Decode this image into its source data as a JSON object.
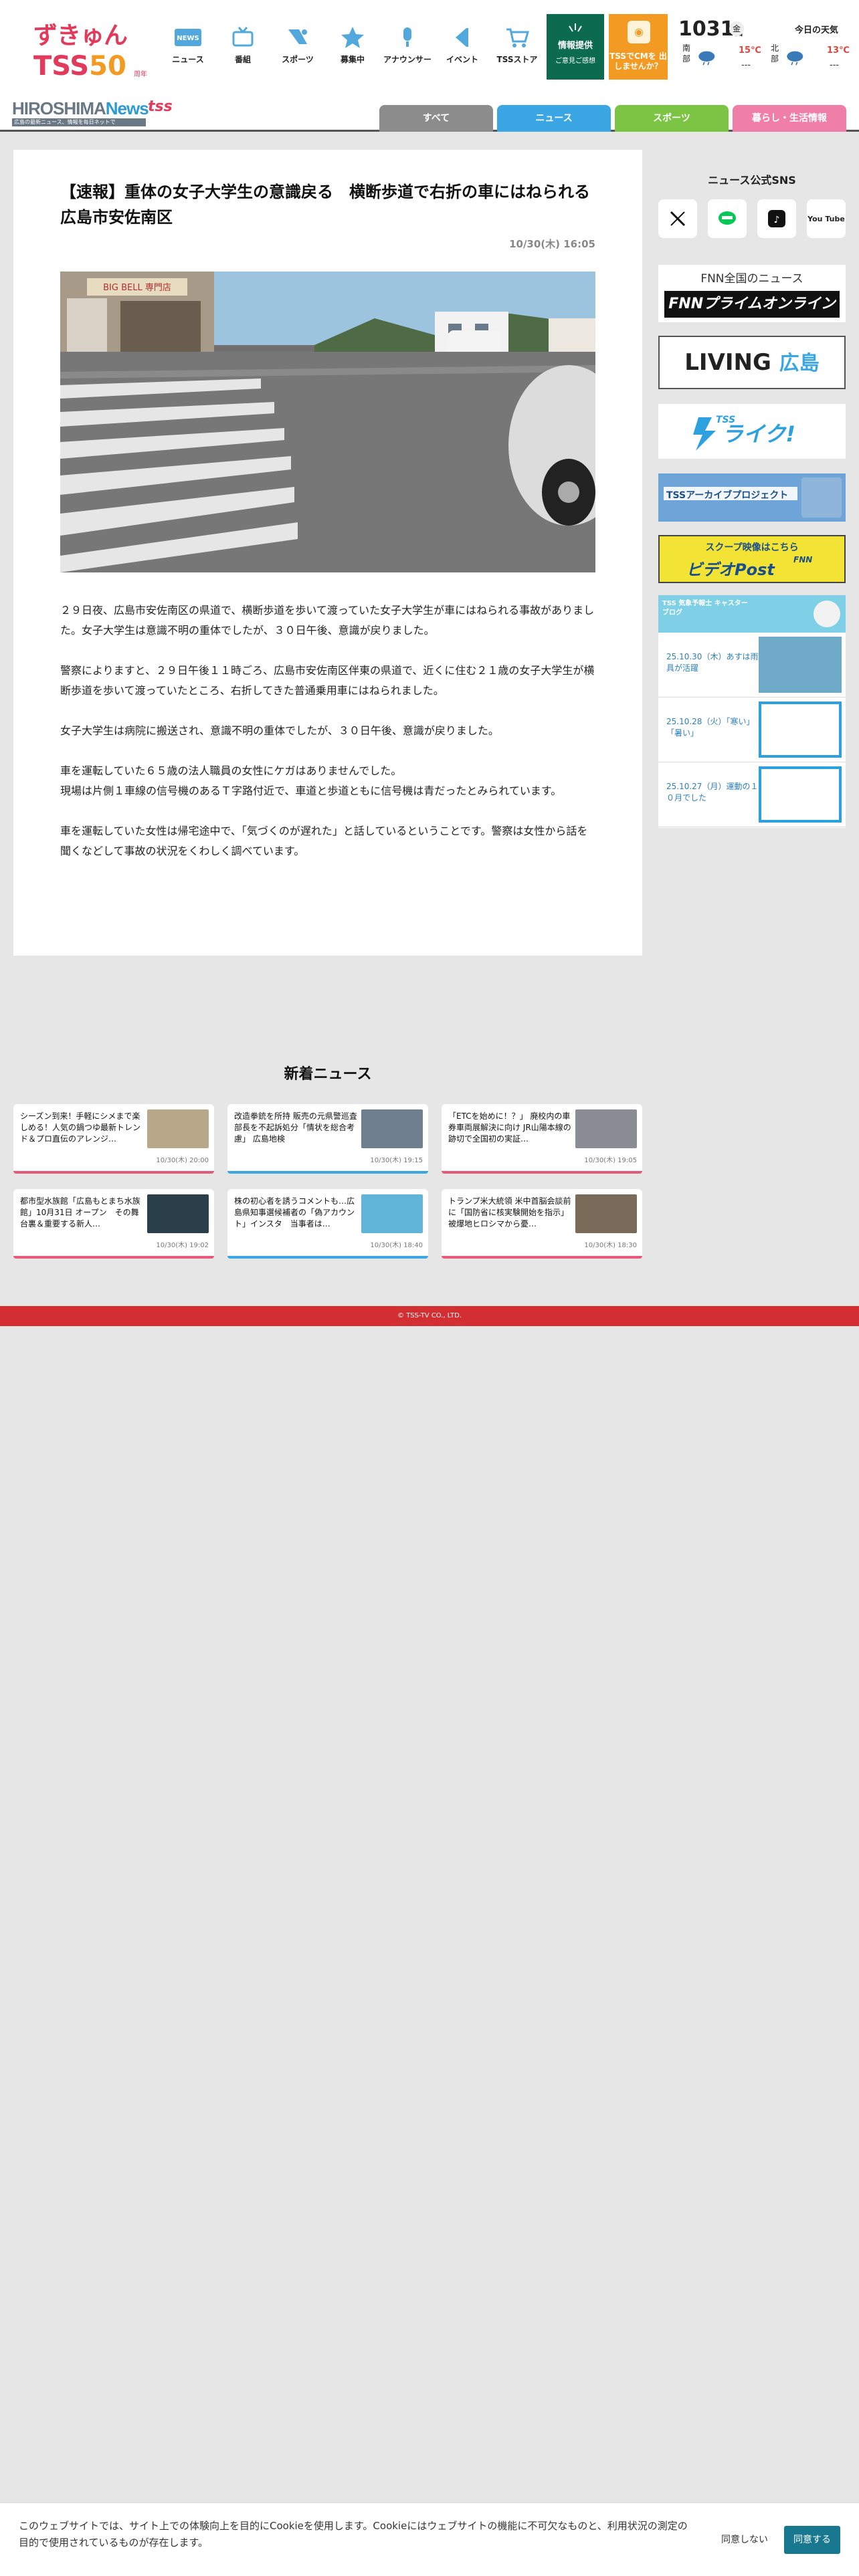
{
  "header": {
    "logo_line1": "ずきゅん",
    "logo_line2": "TSS",
    "logo_num": "50",
    "logo_line3": "周年",
    "nav": [
      {
        "label": "ニュース",
        "icon": "news-icon"
      },
      {
        "label": "番組",
        "icon": "tv-icon"
      },
      {
        "label": "スポーツ",
        "icon": "sports-icon"
      },
      {
        "label": "募集中",
        "icon": "star-icon"
      },
      {
        "label": "アナウンサー",
        "icon": "microphone-icon"
      },
      {
        "label": "イベント",
        "icon": "flag-icon"
      },
      {
        "label": "TSSストア",
        "icon": "cart-icon"
      }
    ],
    "info_label": "情報提供",
    "info_sub": "ご意見ご感想",
    "cm_label": "TSSでCMを 出しませんか？"
  },
  "weather": {
    "month": "10",
    "day": "31",
    "day_suffix": "日",
    "weekday": "金",
    "title": "今日の天気",
    "regions": [
      {
        "name": "南部",
        "hi": "15℃",
        "lo": "---"
      },
      {
        "name": "北部",
        "hi": "13℃",
        "lo": "---"
      }
    ]
  },
  "subheader": {
    "logo_text_a": "HIROSHIMA",
    "logo_text_b": "News",
    "logo_tag": "広島の最新ニュース、情報を毎日ネットで",
    "logo_tss": "tss",
    "tabs": [
      {
        "label": "すべて",
        "color": "#8c8c8c"
      },
      {
        "label": "ニュース",
        "color": "#3aa6e3"
      },
      {
        "label": "スポーツ",
        "color": "#7cc443"
      },
      {
        "label": "暮らし・生活情報",
        "color": "#f07fa8"
      }
    ]
  },
  "article": {
    "title": "【速報】重体の女子大学生の意識戻る　横断歩道で右折の車にはねられる　広島市安佐南区",
    "date": "10/30(木) 16:05",
    "shop_sign": "BIG BELL 専門店",
    "paragraphs": [
      "２９日夜、広島市安佐南区の県道で、横断歩道を歩いて渡っていた女子大学生が車にはねられる事故がありました。女子大学生は意識不明の重体でしたが、３０日午後、意識が戻りました。",
      "警察によりますと、２９日午後１１時ごろ、広島市安佐南区伴東の県道で、近くに住む２１歳の女子大学生が横断歩道を歩いて渡っていたところ、右折してきた普通乗用車にはねられました。",
      "女子大学生は病院に搬送され、意識不明の重体でしたが、３０日午後、意識が戻りました。",
      "車を運転していた６５歳の法人職員の女性にケガはありませんでした。\n現場は片側１車線の信号機のあるＴ字路付近で、車道と歩道ともに信号機は青だったとみられています。",
      "車を運転していた女性は帰宅途中で、「気づくのが遅れた」と話しているということです。警察は女性から話を聞くなどして事故の状況をくわしく調べています。"
    ]
  },
  "sidebar": {
    "sns_title": "ニュース公式SNS",
    "sns": [
      "x-icon",
      "line-icon",
      "tiktok-icon",
      "youtube-icon"
    ],
    "youtube_text": "You Tube",
    "fnn_a": "FNN全国のニュース",
    "fnn_b": "FNNプライムオンライン",
    "living_a": "LIVING",
    "living_b": "広島",
    "like_text": "ライク!",
    "like_tss": "TSS",
    "archive_text": "TSSアーカイブプロジェクト",
    "post_a": "スクープ映像はこちら",
    "post_b": "ビデオPost",
    "post_fnn": "FNN",
    "weather_blog": "TSS 気象予報士 キャスター ブログ",
    "blog_items": [
      "25.10.30（木）あすは雨具が活躍",
      "25.10.28（火）「寒い」「暑い」",
      "25.10.27（月）運動の１０月でした"
    ]
  },
  "new_news": {
    "title": "新着ニュース",
    "cards": [
      {
        "title": "シーズン到来！手軽にシメまで楽しめる！人気の鍋つゆ最新トレンド＆プロ直伝のアレンジ…",
        "date": "10/30(木) 20:00",
        "bar": "#e85a7a",
        "img": "#b8a88a"
      },
      {
        "title": "改造拳銃を所持 販売の元県警巡査部長を不起訴処分「情状を総合考慮」 広島地検",
        "date": "10/30(木) 19:15",
        "bar": "#3aa6e3",
        "img": "#6f7f8f"
      },
      {
        "title": "「ETCを始めに！？」 廃校内の車券車両展解決に向け JR山陽本線の跡切で全国初の実証…",
        "date": "10/30(木) 19:05",
        "bar": "#e85a7a",
        "img": "#8a8e94"
      },
      {
        "title": "都市型水族館「広島もとまち水族館」10月31日 オープン　その舞台裏＆重要する新人…",
        "date": "10/30(木) 19:02",
        "bar": "#e85a7a",
        "img": "#2a3f4a"
      },
      {
        "title": "株の初心者を誘うコメントも…広島県知事選候補者の「偽アカウント」インスタ　当事者は…",
        "date": "10/30(木) 18:40",
        "bar": "#3aa6e3",
        "img": "#5fb4d8"
      },
      {
        "title": "トランプ米大統領 米中首脳会談前に「国防省に核実験開始を指示」被爆地ヒロシマから憂…",
        "date": "10/30(木) 18:30",
        "bar": "#e85a7a",
        "img": "#7a6a5a"
      }
    ]
  },
  "footer": "© TSS-TV CO., LTD.",
  "cookie": {
    "message": "このウェブサイトでは、サイト上での体験向上を目的にCookieを使用します。Cookieにはウェブサイトの機能に不可欠なものと、利用状況の測定の目的で使用されているものが存在します。",
    "deny": "同意しない",
    "agree": "同意する"
  }
}
